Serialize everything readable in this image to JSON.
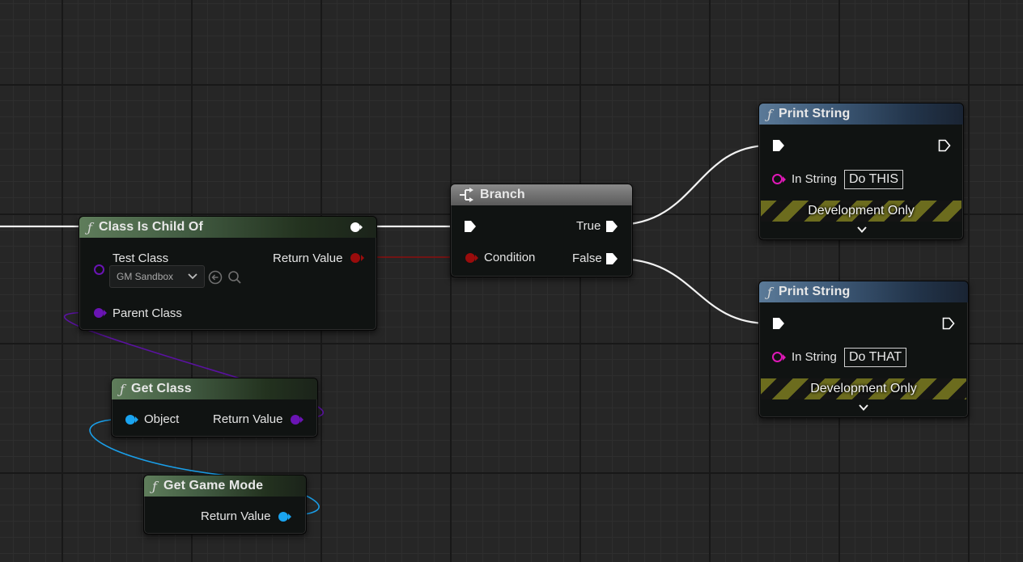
{
  "nodes": {
    "class_is_child_of": {
      "title": "Class Is Child Of",
      "test_class_label": "Test Class",
      "return_value_label": "Return Value",
      "dropdown_value": "GM Sandbox",
      "parent_class_label": "Parent Class"
    },
    "branch": {
      "title": "Branch",
      "condition_label": "Condition",
      "true_label": "True",
      "false_label": "False"
    },
    "get_class": {
      "title": "Get Class",
      "object_label": "Object",
      "return_value_label": "Return Value"
    },
    "get_game_mode": {
      "title": "Get Game Mode",
      "return_value_label": "Return Value"
    },
    "print_string_1": {
      "title": "Print String",
      "in_string_label": "In String",
      "in_string_value": "Do THIS",
      "banner": "Development Only"
    },
    "print_string_2": {
      "title": "Print String",
      "in_string_label": "In String",
      "in_string_value": "Do THAT",
      "banner": "Development Only"
    }
  },
  "icons": {
    "function": "f",
    "branch": "branch-icon",
    "expand": "chevron-down-icon",
    "browse": "arrow-left-circle-icon",
    "search": "search-icon"
  },
  "colors": {
    "exec_wire": "#ffffff",
    "bool_pin": "#9a0c0c",
    "class_pin": "#6a14b4",
    "object_pin": "#1aa4f0",
    "string_pin": "#e018b8",
    "pure_header": "#5f7d5b",
    "impure_header": "#5b7a98"
  }
}
